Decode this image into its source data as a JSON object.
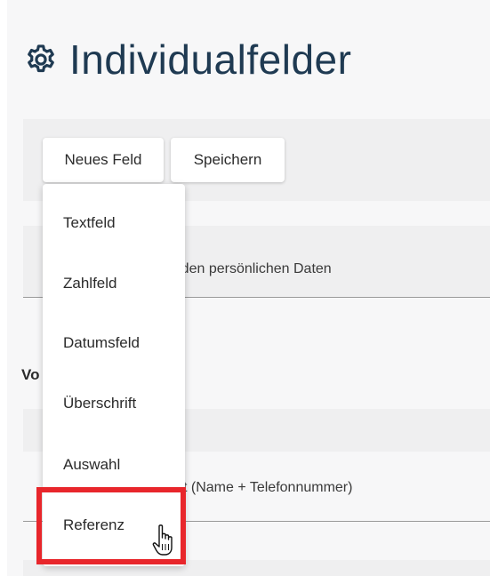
{
  "page": {
    "title": "Individualfelder",
    "title_icon": "gear-icon"
  },
  "toolbar": {
    "new_field_label": "Neues Feld",
    "save_label": "Speichern"
  },
  "background": {
    "section_a_text": "er den persönlichen Daten",
    "section_label": "Vo",
    "section_c_text": "t (Name + Telefonnummer)"
  },
  "dropdown": {
    "items": [
      {
        "label": "Textfeld"
      },
      {
        "label": "Zahlfeld"
      },
      {
        "label": "Datumsfeld"
      },
      {
        "label": "Überschrift"
      },
      {
        "label": "Auswahl"
      },
      {
        "label": "Referenz"
      }
    ],
    "highlighted_item": "Referenz"
  },
  "colors": {
    "title": "#1f3a52",
    "highlight": "#e8262b"
  }
}
